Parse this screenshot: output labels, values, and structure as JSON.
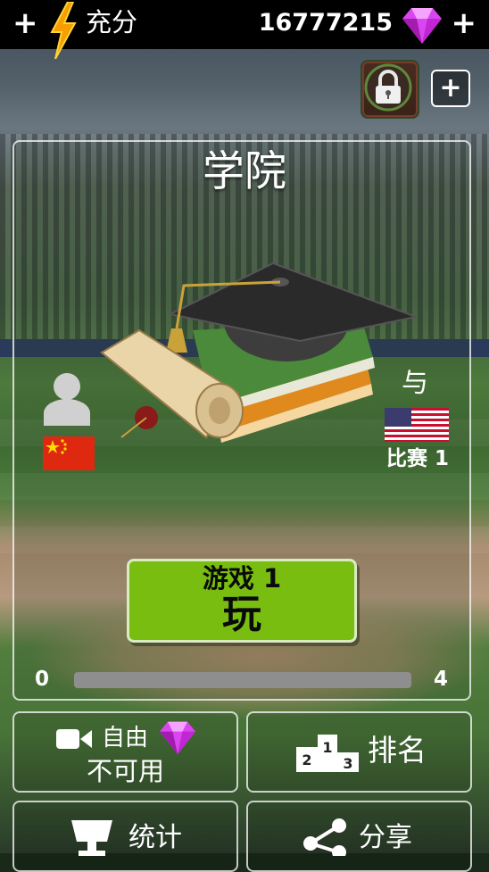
{
  "top_bar": {
    "energy_plus": "+",
    "energy_label": "充分",
    "gems_value": "16777215",
    "gems_plus": "+"
  },
  "header": {
    "add_label": "+"
  },
  "mode": {
    "title": "学院"
  },
  "match": {
    "vs_label": "与",
    "opponent_match_label": "比赛 1"
  },
  "play": {
    "game_label": "游戏 1",
    "play_label": "玩"
  },
  "progress": {
    "min_label": "0",
    "max_label": "4",
    "value": 0,
    "max": 4
  },
  "buttons": {
    "free_label": "自由",
    "unavailable_label": "不可用",
    "rank_label": "排名",
    "stats_label": "统计",
    "share_label": "分享"
  },
  "colors": {
    "play_button": "#79bd10",
    "gem": "#d946ef",
    "bolt": "#f5a000"
  }
}
